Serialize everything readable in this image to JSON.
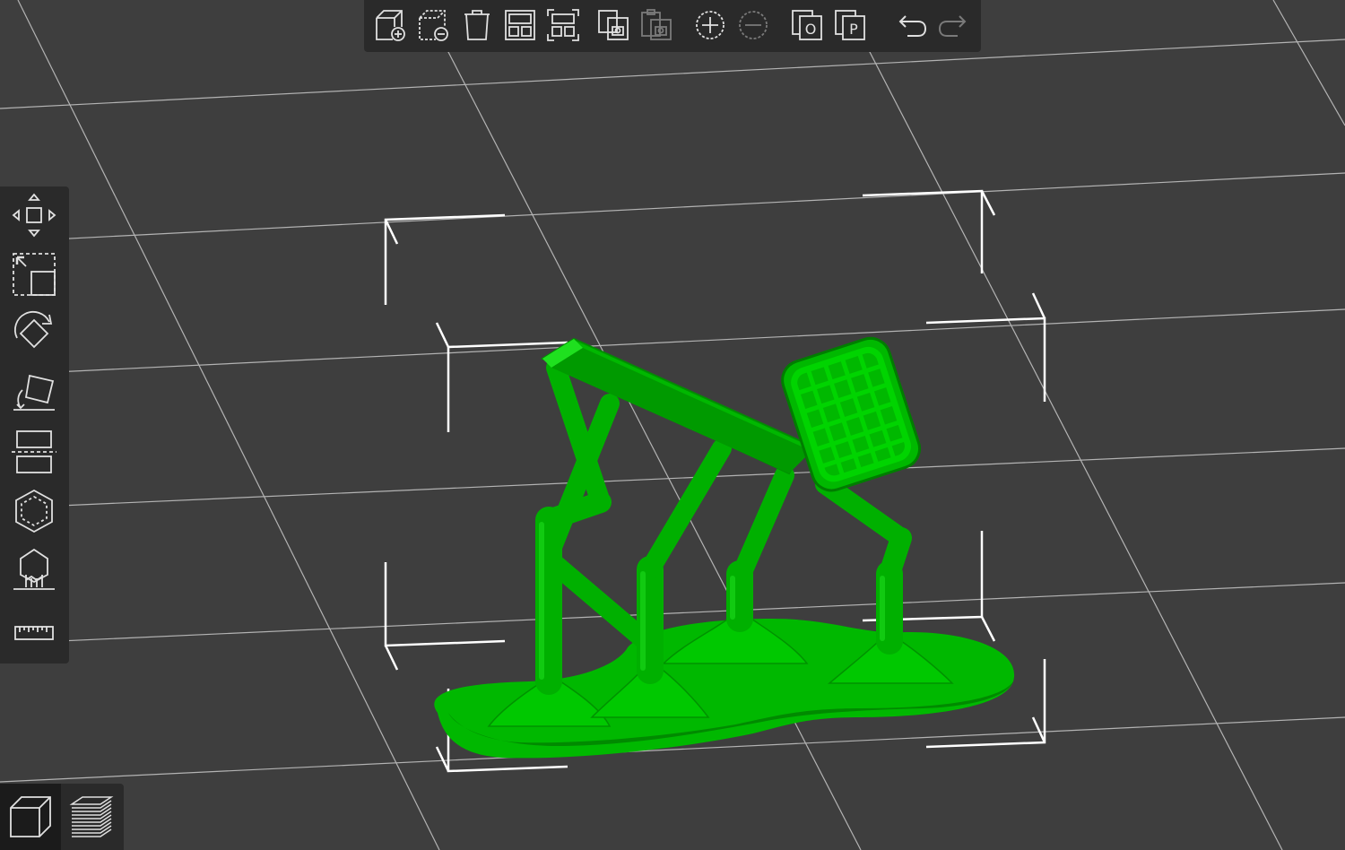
{
  "app": {
    "accent_color": "#00b800",
    "background_color": "#3e3e3e",
    "toolbar_color": "#2a2a2a"
  },
  "top_toolbar": {
    "buttons": [
      {
        "id": "add",
        "icon": "add-object-icon",
        "enabled": true
      },
      {
        "id": "delete",
        "icon": "delete-object-icon",
        "enabled": true
      },
      {
        "id": "delete-all",
        "icon": "trash-icon",
        "enabled": true
      },
      {
        "id": "arrange",
        "icon": "arrange-icon",
        "enabled": true
      },
      {
        "id": "split",
        "icon": "split-icon",
        "enabled": true
      },
      {
        "id": "copy",
        "icon": "copy-icon",
        "enabled": true
      },
      {
        "id": "paste",
        "icon": "paste-icon",
        "enabled": false
      },
      {
        "id": "add-instance",
        "icon": "plus-circle-icon",
        "enabled": true
      },
      {
        "id": "remove-instance",
        "icon": "minus-circle-icon",
        "enabled": false
      },
      {
        "id": "split-to-objects",
        "icon": "split-objects-icon",
        "glyph": "O",
        "enabled": true
      },
      {
        "id": "split-to-parts",
        "icon": "split-parts-icon",
        "glyph": "P",
        "enabled": true
      },
      {
        "id": "undo",
        "icon": "undo-icon",
        "enabled": true
      },
      {
        "id": "redo",
        "icon": "redo-icon",
        "enabled": false
      }
    ]
  },
  "left_toolbar": {
    "tools": [
      {
        "id": "move",
        "icon": "move-icon"
      },
      {
        "id": "scale",
        "icon": "scale-icon"
      },
      {
        "id": "rotate",
        "icon": "rotate-icon"
      },
      {
        "id": "place-on-face",
        "icon": "place-on-face-icon"
      },
      {
        "id": "cut",
        "icon": "cut-icon"
      },
      {
        "id": "hollow",
        "icon": "hollow-icon"
      },
      {
        "id": "sla-support-points",
        "icon": "support-points-icon"
      },
      {
        "id": "measure",
        "icon": "ruler-icon"
      }
    ]
  },
  "view_tabs": [
    {
      "id": "3d",
      "icon": "3d-view-icon",
      "active": true
    },
    {
      "id": "preview",
      "icon": "layers-preview-icon",
      "active": false
    }
  ],
  "scene": {
    "model_color": "#00b800",
    "model_color_light": "#1fe01f",
    "model_color_dark": "#008a00",
    "bed_grid_color": "#c8c8c8",
    "selection_box_color": "#ffffff"
  }
}
